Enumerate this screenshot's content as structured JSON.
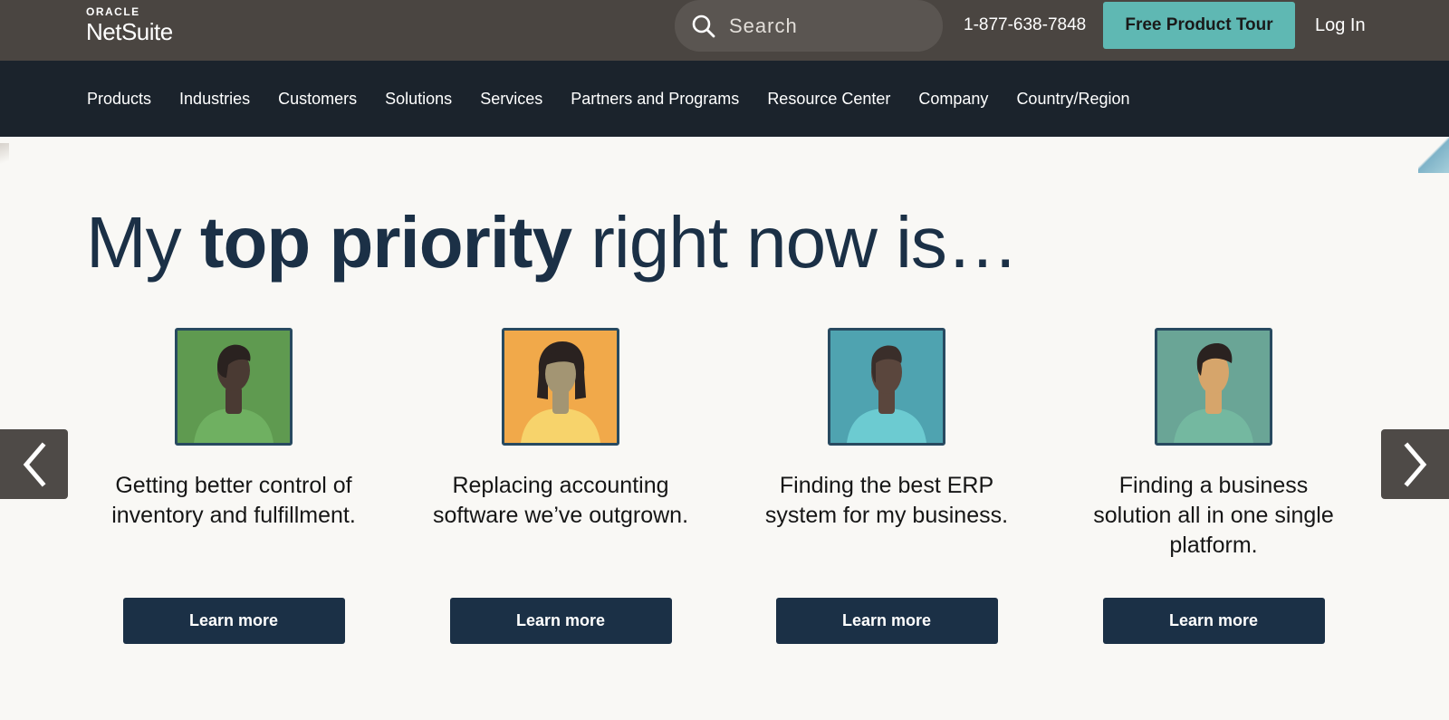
{
  "header": {
    "logo_top": "ORACLE",
    "logo_main": "NetSuite",
    "search_placeholder": "Search",
    "phone": "1-877-638-7848",
    "tour_button": "Free Product Tour",
    "login": "Log In"
  },
  "nav": {
    "items": [
      {
        "label": "Products"
      },
      {
        "label": "Industries"
      },
      {
        "label": "Customers"
      },
      {
        "label": "Solutions"
      },
      {
        "label": "Services"
      },
      {
        "label": "Partners and Programs"
      },
      {
        "label": "Resource Center"
      },
      {
        "label": "Company"
      },
      {
        "label": "Country/Region"
      }
    ]
  },
  "hero": {
    "headline_start": "My ",
    "headline_bold": "top priority",
    "headline_end": " right now is…"
  },
  "cards": [
    {
      "text": "Getting better control of inventory and fulfillment.",
      "button": "Learn more",
      "bg": "#5f9a50",
      "shirt": "#6fb061",
      "skin": "#4a3a33",
      "hair": "#2a2220"
    },
    {
      "text": "Replacing accounting software we’ve outgrown.",
      "button": "Learn more",
      "bg": "#f1a94a",
      "shirt": "#f7d36b",
      "skin": "#a39573",
      "hair": "#2a2220"
    },
    {
      "text": "Finding the best ERP system for my business.",
      "button": "Learn more",
      "bg": "#4fa3b0",
      "shirt": "#6ccbd1",
      "skin": "#5a463d",
      "hair": "#3a2e2a"
    },
    {
      "text": "Finding a business solution all in one single platform.",
      "button": "Learn more",
      "bg": "#6aa596",
      "shirt": "#74b8a0",
      "skin": "#d6a56b",
      "hair": "#2a2220"
    }
  ],
  "colors": {
    "topbar": "#4a4541",
    "navbar": "#1b232c",
    "accent": "#5fb8b3",
    "headline": "#1b3046",
    "button": "#1b3046"
  },
  "icons": {
    "search": "search-icon",
    "prev": "chevron-left-icon",
    "next": "chevron-right-icon"
  }
}
